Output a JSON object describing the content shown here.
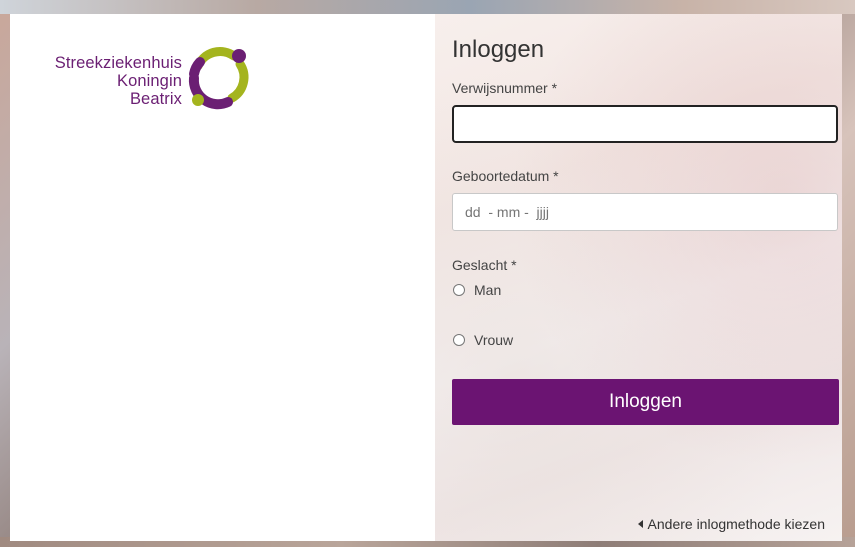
{
  "logo": {
    "lines": [
      "Streekziekenhuis",
      "Koningin",
      "Beatrix"
    ],
    "brand_purple": "#6b1f73",
    "brand_green": "#a4b41e"
  },
  "form": {
    "title": "Inloggen",
    "referral_label": "Verwijsnummer *",
    "referral_value": "",
    "birthdate_label": "Geboortedatum *",
    "birthdate_placeholder": "dd  - mm -  jjjj",
    "gender_label": "Geslacht *",
    "gender_options": [
      "Man",
      "Vrouw"
    ],
    "submit_label": "Inloggen",
    "alt_method_link": "Andere inlogmethode kiezen"
  },
  "colors": {
    "button": "#6b1472",
    "text": "#444444"
  }
}
